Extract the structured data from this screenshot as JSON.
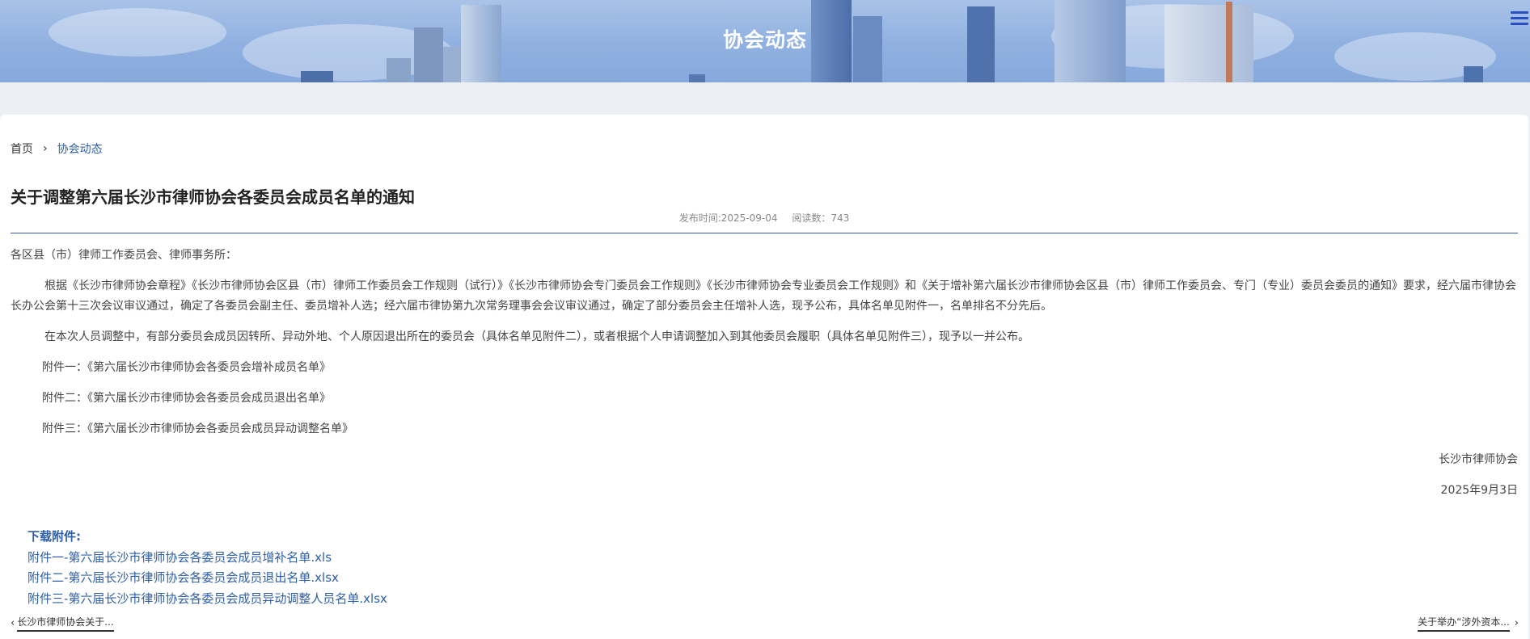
{
  "banner": {
    "title": "协会动态"
  },
  "breadcrumb": {
    "home": "首页",
    "current": "协会动态"
  },
  "article": {
    "title": "关于调整第六届长沙市律师协会各委员会成员名单的通知",
    "publish_time": "发布时间:2025-09-04",
    "read_count": "阅读数：743",
    "salutation": "各区县（市）律师工作委员会、律师事务所：",
    "para1": "根据《长沙市律师协会章程》《长沙市律师协会区县（市）律师工作委员会工作规则（试行）》《长沙市律师协会专门委员会工作规则》《长沙市律师协会专业委员会工作规则》和《关于增补第六届长沙市律师协会区县（市）律师工作委员会、专门（专业）委员会委员的通知》要求，经六届市律协会长办公会第十三次会议审议通过，确定了各委员会副主任、委员增补人选；经六届市律协第九次常务理事会会议审议通过，确定了部分委员会主任增补人选，现予公布，具体名单见附件一，名单排名不分先后。",
    "para2": "在本次人员调整中，有部分委员会成员因转所、异动外地、个人原因退出所在的委员会（具体名单见附件二），或者根据个人申请调整加入到其他委员会履职（具体名单见附件三），现予以一并公布。",
    "attachment1": "附件一：《第六届长沙市律师协会各委员会增补成员名单》",
    "attachment2": "附件二：《第六届长沙市律师协会各委员会成员退出名单》",
    "attachment3": "附件三：《第六届长沙市律师协会各委员会成员异动调整名单》",
    "signature": "长沙市律师协会",
    "date": "2025年9月3日"
  },
  "downloads": {
    "label": "下载附件:",
    "files": [
      "附件一-第六届长沙市律师协会各委员会成员增补名单.xls",
      "附件二-第六届长沙市律师协会各委员会成员退出名单.xlsx",
      "附件三-第六届长沙市律师协会各委员会成员异动调整人员名单.xlsx"
    ]
  },
  "pager": {
    "prev": "长沙市律师协会关于...",
    "next": "关于举办“涉外资本..."
  },
  "icons": {
    "menu": "hamburger-menu-icon",
    "prev": "chevron-left-icon",
    "next": "chevron-right-icon",
    "breadcrumb_sep": "chevron-right-icon"
  },
  "colors": {
    "accent": "#2f5fa8",
    "menu": "#2a4fc0"
  }
}
